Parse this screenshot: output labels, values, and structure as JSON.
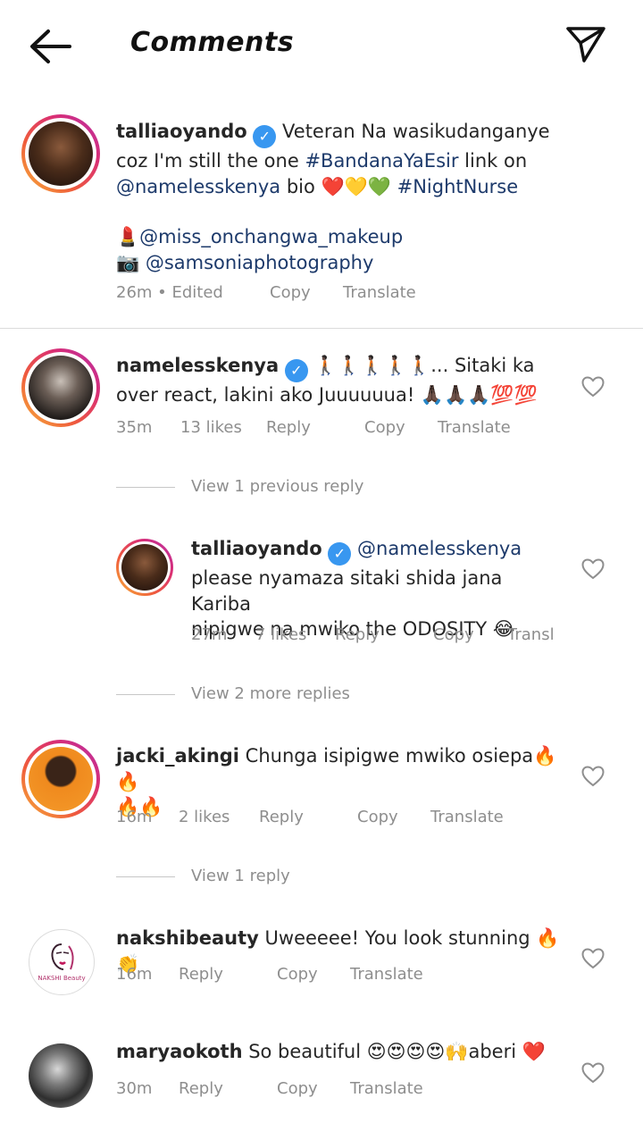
{
  "header": {
    "title": "Comments"
  },
  "caption": {
    "user": "talliaoyando",
    "line1": "Veteran Na wasikudanganye",
    "line2a": "coz I'm still the one ",
    "line2b": "#BandanaYaEsir",
    "line2c": " link on",
    "line3a": "@namelesskenya",
    "line3b": " bio ❤️💛💚 ",
    "line3c": "#NightNurse",
    "line4a": "💄",
    "line4b": "@miss_onchangwa_makeup",
    "line5a": "📷",
    "line5b": "@samsoniaphotography",
    "time": "26m • Edited",
    "copy": "Copy",
    "translate": "Translate"
  },
  "comments": [
    {
      "user": "namelesskenya",
      "line1": " 🚶🏿🚶🏿🚶🏿🚶🏿🚶🏿... Sitaki ka",
      "line2": "over react, lakini ako Juuuuuua! 🙏🏿🙏🏿🙏🏿💯💯",
      "time": "35m",
      "likes": "13 likes",
      "reply": "Reply",
      "copy": "Copy",
      "translate": "Translate",
      "view": "View 1 previous reply"
    },
    {
      "user": "talliaoyando",
      "mention": "@namelesskenya",
      "line2": "please nyamaza sitaki shida jana Kariba",
      "line3": "nipigwe na mwiko the ODOSITY 😂",
      "time": "27m",
      "likes": "7 likes",
      "reply": "Reply",
      "copy": "Copy",
      "translate": "Transl",
      "view": "View 2 more replies"
    },
    {
      "user": "jacki_akingi",
      "line1": " Chunga isipigwe mwiko osiepa🔥🔥",
      "line2": "🔥🔥",
      "time": "16m",
      "likes": "2 likes",
      "reply": "Reply",
      "copy": "Copy",
      "translate": "Translate",
      "view": "View 1 reply"
    },
    {
      "user": "nakshibeauty",
      "line1": " Uweeeee! You look stunning 🔥👏",
      "time": "16m",
      "reply": "Reply",
      "copy": "Copy",
      "translate": "Translate",
      "avatar_text": "NAKSHI Beauty"
    },
    {
      "user": "maryaokoth",
      "line1": " So beautiful 😍😍😍😍🙌aberi ❤️",
      "time": "30m",
      "reply": "Reply",
      "copy": "Copy",
      "translate": "Translate"
    }
  ],
  "colors": {
    "link": "#1d3a6b",
    "verified": "#3897f0",
    "meta": "#8e8e8e"
  }
}
